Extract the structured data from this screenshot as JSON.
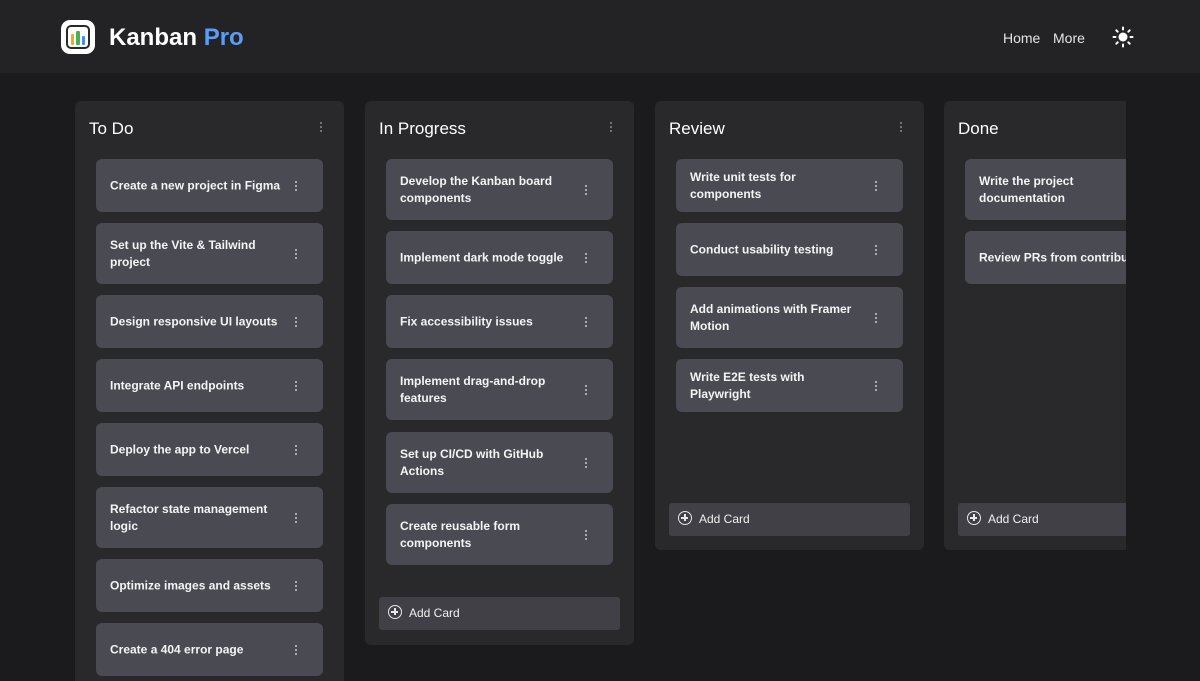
{
  "header": {
    "brand_primary": "Kanban",
    "brand_accent": "Pro",
    "accent_color": "#5b9cf6",
    "nav": [
      {
        "label": "Home"
      },
      {
        "label": "More"
      }
    ],
    "theme_icon": "sun-icon"
  },
  "columns": [
    {
      "title": "To Do",
      "cards": [
        {
          "text": "Create a new project in Figma"
        },
        {
          "text": "Set up the Vite & Tailwind project"
        },
        {
          "text": "Design responsive UI layouts"
        },
        {
          "text": "Integrate API endpoints"
        },
        {
          "text": "Deploy the app to Vercel"
        },
        {
          "text": "Refactor state management logic"
        },
        {
          "text": "Optimize images and assets"
        },
        {
          "text": "Create a 404 error page"
        }
      ]
    },
    {
      "title": "In Progress",
      "cards": [
        {
          "text": "Develop the Kanban board components"
        },
        {
          "text": "Implement dark mode toggle"
        },
        {
          "text": "Fix accessibility issues"
        },
        {
          "text": "Implement drag-and-drop features"
        },
        {
          "text": "Set up CI/CD with GitHub Actions"
        },
        {
          "text": "Create reusable form components"
        }
      ],
      "add_label": "Add Card"
    },
    {
      "title": "Review",
      "cards": [
        {
          "text": "Write unit tests for components"
        },
        {
          "text": "Conduct usability testing"
        },
        {
          "text": "Add animations with Framer Motion"
        },
        {
          "text": "Write E2E tests with Playwright"
        }
      ],
      "add_label": "Add Card"
    },
    {
      "title": "Done",
      "cards": [
        {
          "text": "Write the project documentation"
        },
        {
          "text": "Review PRs from contributors"
        }
      ],
      "add_label": "Add Card"
    }
  ]
}
